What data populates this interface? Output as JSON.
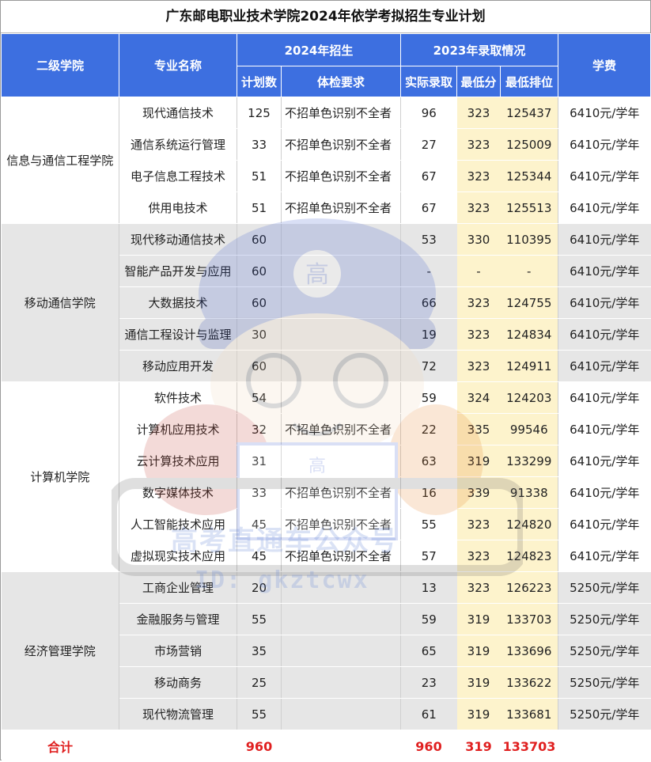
{
  "title": "广东邮电职业技术学院2024年依学考拟招生专业计划",
  "headers": {
    "college": "二级学院",
    "major": "专业名称",
    "group2024": "2024年招生",
    "group2023": "2023年录取情况",
    "fee": "学费",
    "plan": "计划数",
    "req": "体检要求",
    "actual": "实际录取",
    "min": "最低分",
    "rank": "最低排位"
  },
  "colleges": [
    {
      "name": "信息与通信工程学院"
    },
    {
      "name": "移动通信学院"
    },
    {
      "name": "计算机学院"
    },
    {
      "name": "经济管理学院"
    }
  ],
  "rows": [
    {
      "major": "现代通信技术",
      "plan": "125",
      "req": "不招单色识别不全者",
      "actual": "96",
      "min": "323",
      "rank": "125437",
      "fee": "6410元/学年"
    },
    {
      "major": "通信系统运行管理",
      "plan": "33",
      "req": "不招单色识别不全者",
      "actual": "27",
      "min": "323",
      "rank": "125009",
      "fee": "6410元/学年"
    },
    {
      "major": "电子信息工程技术",
      "plan": "51",
      "req": "不招单色识别不全者",
      "actual": "67",
      "min": "323",
      "rank": "125344",
      "fee": "6410元/学年"
    },
    {
      "major": "供用电技术",
      "plan": "51",
      "req": "不招单色识别不全者",
      "actual": "67",
      "min": "323",
      "rank": "125513",
      "fee": "6410元/学年"
    },
    {
      "major": "现代移动通信技术",
      "plan": "60",
      "req": "",
      "actual": "53",
      "min": "330",
      "rank": "110395",
      "fee": "6410元/学年"
    },
    {
      "major": "智能产品开发与应用",
      "plan": "60",
      "req": "",
      "actual": "-",
      "min": "-",
      "rank": "-",
      "fee": "6410元/学年"
    },
    {
      "major": "大数据技术",
      "plan": "60",
      "req": "",
      "actual": "66",
      "min": "323",
      "rank": "124755",
      "fee": "6410元/学年"
    },
    {
      "major": "通信工程设计与监理",
      "plan": "30",
      "req": "",
      "actual": "19",
      "min": "323",
      "rank": "124834",
      "fee": "6410元/学年"
    },
    {
      "major": "移动应用开发",
      "plan": "60",
      "req": "",
      "actual": "72",
      "min": "323",
      "rank": "124911",
      "fee": "6410元/学年"
    },
    {
      "major": "软件技术",
      "plan": "54",
      "req": "",
      "actual": "59",
      "min": "324",
      "rank": "124203",
      "fee": "6410元/学年"
    },
    {
      "major": "计算机应用技术",
      "plan": "32",
      "req": "不招单色识别不全者",
      "actual": "22",
      "min": "335",
      "rank": "99546",
      "fee": "6410元/学年"
    },
    {
      "major": "云计算技术应用",
      "plan": "31",
      "req": "",
      "actual": "63",
      "min": "319",
      "rank": "133299",
      "fee": "6410元/学年"
    },
    {
      "major": "数字媒体技术",
      "plan": "33",
      "req": "不招单色识别不全者",
      "actual": "16",
      "min": "339",
      "rank": "91338",
      "fee": "6410元/学年"
    },
    {
      "major": "人工智能技术应用",
      "plan": "45",
      "req": "不招单色识别不全者",
      "actual": "55",
      "min": "323",
      "rank": "124820",
      "fee": "6410元/学年"
    },
    {
      "major": "虚拟现实技术应用",
      "plan": "45",
      "req": "不招单色识别不全者",
      "actual": "57",
      "min": "323",
      "rank": "124823",
      "fee": "6410元/学年"
    },
    {
      "major": "工商企业管理",
      "plan": "20",
      "req": "",
      "actual": "13",
      "min": "323",
      "rank": "126223",
      "fee": "5250元/学年"
    },
    {
      "major": "金融服务与管理",
      "plan": "55",
      "req": "",
      "actual": "59",
      "min": "319",
      "rank": "133703",
      "fee": "5250元/学年"
    },
    {
      "major": "市场营销",
      "plan": "35",
      "req": "",
      "actual": "65",
      "min": "319",
      "rank": "133696",
      "fee": "5250元/学年"
    },
    {
      "major": "移动商务",
      "plan": "25",
      "req": "",
      "actual": "23",
      "min": "319",
      "rank": "133622",
      "fee": "5250元/学年"
    },
    {
      "major": "现代物流管理",
      "plan": "55",
      "req": "",
      "actual": "61",
      "min": "319",
      "rank": "133681",
      "fee": "5250元/学年"
    }
  ],
  "total": {
    "label": "合计",
    "plan": "960",
    "actual": "960",
    "min": "319",
    "rank": "133703"
  },
  "watermark": {
    "cap_char": "高",
    "shirt_char": "高",
    "line1": "高考直通车公众号",
    "line2": "ID: gkztcwx"
  },
  "colors": {
    "header_blue": "#3d6fe0",
    "highlight_yellow": "#fdf3cc",
    "total_red": "#e02020",
    "band_gray": "#e6e6e6"
  }
}
